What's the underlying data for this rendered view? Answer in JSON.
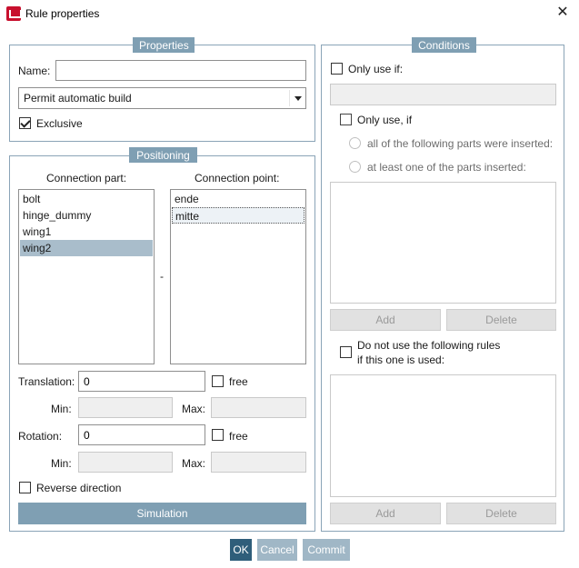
{
  "window": {
    "title": "Rule properties",
    "close_glyph": "✕"
  },
  "properties": {
    "legend": "Properties",
    "name_label": "Name:",
    "name_value": "",
    "build_select": "Permit automatic build",
    "exclusive_label": "Exclusive",
    "exclusive_checked": true
  },
  "positioning": {
    "legend": "Positioning",
    "connection_part_header": "Connection part:",
    "connection_point_header": "Connection point:",
    "parts": [
      "bolt",
      "hinge_dummy",
      "wing1",
      "wing2"
    ],
    "selected_part": "wing2",
    "points": [
      "ende",
      "mitte"
    ],
    "focused_point": "mitte",
    "separator": "-",
    "translation_label": "Translation:",
    "translation_value": "0",
    "translation_free_label": "free",
    "min_label": "Min:",
    "max_label": "Max:",
    "rotation_label": "Rotation:",
    "rotation_value": "0",
    "rotation_free_label": "free",
    "reverse_label": "Reverse direction",
    "simulation_label": "Simulation"
  },
  "conditions": {
    "legend": "Conditions",
    "only_use_if_label": "Only use if:",
    "only_use_if_comma_label": "Only use, if",
    "radio_all_label": "all of the following parts were inserted:",
    "radio_one_label": "at least one of the parts inserted:",
    "add_label": "Add",
    "delete_label": "Delete",
    "do_not_use_line1": "Do not use the following rules",
    "do_not_use_line2": "if this one is used:",
    "add2_label": "Add",
    "delete2_label": "Delete"
  },
  "footer": {
    "ok_label": "OK",
    "cancel_label": "Cancel",
    "commit_label": "Commit"
  },
  "colors": {
    "accent": "#7f9fb3",
    "selection": "#a9bdcb",
    "brand_icon": "#c8102e"
  },
  "icons": [
    "app-icon",
    "close-icon",
    "chevron-down-icon"
  ]
}
